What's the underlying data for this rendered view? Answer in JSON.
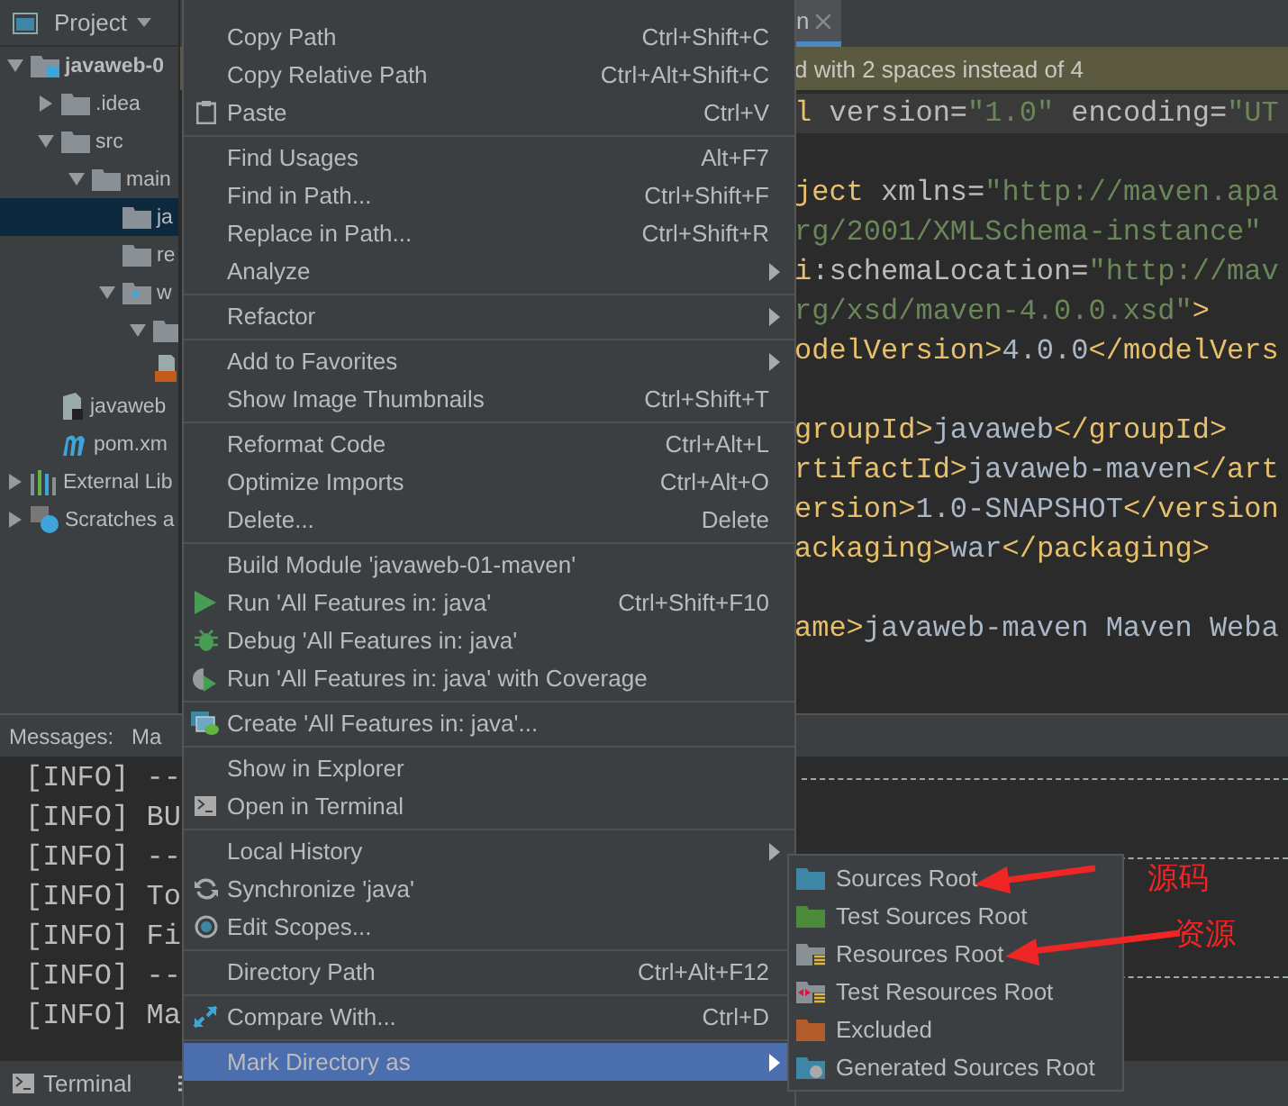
{
  "project_panel": {
    "title": "Project",
    "tree": [
      {
        "label": "javaweb-0",
        "kind": "module",
        "expanded": true,
        "selected": false,
        "children": [
          {
            "label": ".idea",
            "kind": "folder",
            "expanded": false,
            "selected": false
          },
          {
            "label": "src",
            "kind": "folder",
            "expanded": true,
            "selected": false,
            "children": [
              {
                "label": "main",
                "kind": "folder",
                "expanded": true,
                "selected": false,
                "children": [
                  {
                    "label": "ja",
                    "kind": "folder",
                    "selected": true
                  },
                  {
                    "label": "re",
                    "kind": "folder",
                    "selected": false
                  },
                  {
                    "label": "w",
                    "kind": "web-folder",
                    "expanded": true,
                    "selected": false,
                    "children": [
                      {
                        "kind": "folder",
                        "expanded": true,
                        "selected": false
                      },
                      {
                        "kind": "js-file",
                        "selected": false
                      }
                    ]
                  }
                ]
              }
            ]
          },
          {
            "label": "javaweb",
            "kind": "iml-file",
            "selected": false
          },
          {
            "label": "pom.xm",
            "kind": "maven-file",
            "selected": false
          }
        ]
      },
      {
        "label": "External Lib",
        "kind": "libraries",
        "expanded": false,
        "selected": false
      },
      {
        "label": "Scratches a",
        "kind": "scratches",
        "expanded": false,
        "selected": false
      }
    ]
  },
  "editor": {
    "tab": {
      "label": "n"
    },
    "notice": "d with 2 spaces instead of 4",
    "lines": [
      {
        "current": true,
        "segments": [
          {
            "text": "l",
            "kind": "tag"
          },
          {
            "text": " version=",
            "kind": "attr"
          },
          {
            "text": "\"1.0\"",
            "kind": "value"
          },
          {
            "text": " encoding=",
            "kind": "attr"
          },
          {
            "text": "\"UT",
            "kind": "value"
          }
        ]
      },
      {
        "current": false
      },
      {
        "current": false,
        "segments": [
          {
            "text": "ject",
            "kind": "tag"
          },
          {
            "text": " xmlns=",
            "kind": "attr"
          },
          {
            "text": "\"http://maven.apa",
            "kind": "value"
          }
        ]
      },
      {
        "current": false,
        "segments": [
          {
            "text": "rg/2001/XMLSchema-instance\"",
            "kind": "value"
          }
        ]
      },
      {
        "current": false,
        "segments": [
          {
            "text": "i",
            "kind": "tag"
          },
          {
            "text": ":schemaLocation=",
            "kind": "attr"
          },
          {
            "text": "\"http://mav",
            "kind": "value"
          }
        ]
      },
      {
        "current": false,
        "segments": [
          {
            "text": "rg/xsd/maven-4.0.0.xsd\"",
            "kind": "value"
          },
          {
            "text": ">",
            "kind": "tag"
          }
        ]
      },
      {
        "current": false,
        "segments": [
          {
            "text": "odelVersion>",
            "kind": "tag"
          },
          {
            "text": "4.0.0",
            "kind": "text"
          },
          {
            "text": "</modelVers",
            "kind": "tag"
          }
        ]
      },
      {
        "current": false
      },
      {
        "current": false,
        "segments": [
          {
            "text": "groupId>",
            "kind": "tag"
          },
          {
            "text": "javaweb",
            "kind": "text"
          },
          {
            "text": "</groupId>",
            "kind": "tag"
          }
        ]
      },
      {
        "current": false,
        "segments": [
          {
            "text": "rtifactId>",
            "kind": "tag"
          },
          {
            "text": "javaweb-maven",
            "kind": "text"
          },
          {
            "text": "</art",
            "kind": "tag"
          }
        ]
      },
      {
        "current": false,
        "segments": [
          {
            "text": "ersion>",
            "kind": "tag"
          },
          {
            "text": "1.0-SNAPSHOT",
            "kind": "text"
          },
          {
            "text": "</version",
            "kind": "tag"
          }
        ]
      },
      {
        "current": false,
        "segments": [
          {
            "text": "ackaging>",
            "kind": "tag"
          },
          {
            "text": "war",
            "kind": "text"
          },
          {
            "text": "</packaging>",
            "kind": "tag"
          }
        ]
      },
      {
        "current": false
      },
      {
        "current": false,
        "segments": [
          {
            "text": "ame>",
            "kind": "tag"
          },
          {
            "text": "javaweb-maven Maven Weba",
            "kind": "text"
          }
        ]
      }
    ]
  },
  "messages": {
    "title": "Messages:",
    "tab": "Ma",
    "log": [
      {
        "level": "[INFO]",
        "text": "--",
        "rule": true
      },
      {
        "level": "[INFO]",
        "text": "BU",
        "rule": false
      },
      {
        "level": "[INFO]",
        "text": "--",
        "rule": true
      },
      {
        "level": "[INFO]",
        "text": "To",
        "rule": false
      },
      {
        "level": "[INFO]",
        "text": "Fi",
        "rule": false
      },
      {
        "level": "[INFO]",
        "text": "--",
        "rule": true
      },
      {
        "level": "[INFO]",
        "text": "Ma",
        "rule": false
      }
    ]
  },
  "bottom_bar": {
    "terminal": "Terminal"
  },
  "context_menu": {
    "groups": [
      [
        {
          "label": "Copy Path",
          "shortcut": "Ctrl+Shift+C",
          "selected": false
        },
        {
          "label": "Copy Relative Path",
          "shortcut": "Ctrl+Alt+Shift+C",
          "selected": false
        },
        {
          "label": "Paste",
          "shortcut": "Ctrl+V",
          "kind": "paste",
          "selected": false
        }
      ],
      [
        {
          "label": "Find Usages",
          "shortcut": "Alt+F7",
          "selected": false
        },
        {
          "label": "Find in Path...",
          "shortcut": "Ctrl+Shift+F",
          "selected": false
        },
        {
          "label": "Replace in Path...",
          "shortcut": "Ctrl+Shift+R",
          "selected": false
        },
        {
          "label": "Analyze",
          "submenu": true,
          "selected": false
        }
      ],
      [
        {
          "label": "Refactor",
          "submenu": true,
          "selected": false
        }
      ],
      [
        {
          "label": "Add to Favorites",
          "submenu": true,
          "selected": false
        },
        {
          "label": "Show Image Thumbnails",
          "shortcut": "Ctrl+Shift+T",
          "selected": false
        }
      ],
      [
        {
          "label": "Reformat Code",
          "shortcut": "Ctrl+Alt+L",
          "selected": false
        },
        {
          "label": "Optimize Imports",
          "shortcut": "Ctrl+Alt+O",
          "selected": false
        },
        {
          "label": "Delete...",
          "shortcut": "Delete",
          "selected": false
        }
      ],
      [
        {
          "label": "Build Module 'javaweb-01-maven'",
          "selected": false
        },
        {
          "label": "Run 'All Features in: java'",
          "shortcut": "Ctrl+Shift+F10",
          "kind": "run",
          "selected": false
        },
        {
          "label": "Debug 'All Features in: java'",
          "kind": "debug",
          "selected": false
        },
        {
          "label": "Run 'All Features in: java' with Coverage",
          "kind": "coverage",
          "selected": false
        }
      ],
      [
        {
          "label": "Create 'All Features in: java'...",
          "kind": "create",
          "selected": false
        }
      ],
      [
        {
          "label": "Show in Explorer",
          "selected": false
        },
        {
          "label": "Open in Terminal",
          "kind": "terminal",
          "selected": false
        }
      ],
      [
        {
          "label": "Local History",
          "submenu": true,
          "selected": false
        },
        {
          "label": "Synchronize 'java'",
          "kind": "sync",
          "selected": false
        },
        {
          "label": "Edit Scopes...",
          "kind": "scopes",
          "selected": false
        }
      ],
      [
        {
          "label": "Directory Path",
          "shortcut": "Ctrl+Alt+F12",
          "selected": false
        }
      ],
      [
        {
          "label": "Compare With...",
          "shortcut": "Ctrl+D",
          "kind": "compare",
          "selected": false
        }
      ],
      [
        {
          "label": "Mark Directory as",
          "submenu": true,
          "selected": true
        }
      ]
    ]
  },
  "submenu": {
    "items": [
      {
        "label": "Sources Root",
        "kind": "folder",
        "color": "#3e86a5"
      },
      {
        "label": "Test Sources Root",
        "kind": "folder",
        "color": "#4c8a3c"
      },
      {
        "label": "Resources Root",
        "kind": "resources",
        "color": "#8a9196"
      },
      {
        "label": "Test Resources Root",
        "kind": "test-resources",
        "color": "#8a9196"
      },
      {
        "label": "Excluded",
        "kind": "folder",
        "color": "#b35c2c"
      },
      {
        "label": "Generated Sources Root",
        "kind": "generated",
        "color": "#3e86a5"
      }
    ]
  },
  "annotations": [
    {
      "label": "源码"
    },
    {
      "label": "资源"
    }
  ]
}
